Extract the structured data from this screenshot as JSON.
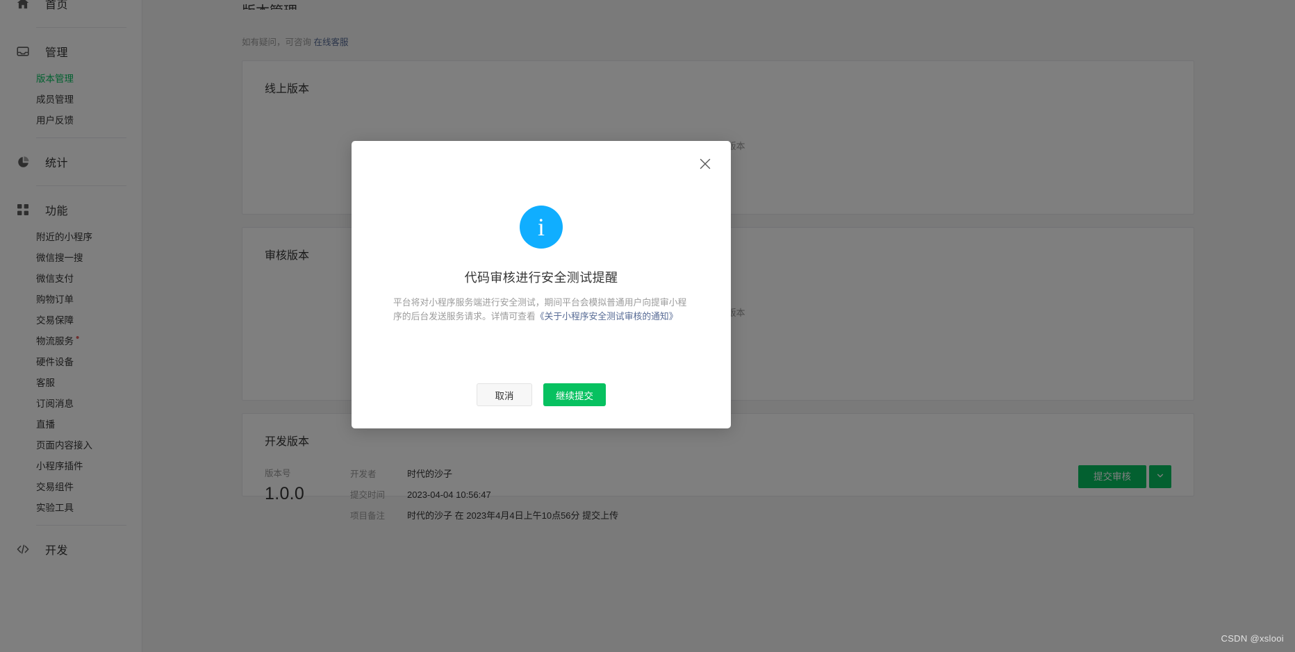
{
  "sidebar": {
    "groups": [
      {
        "icon": "home-icon",
        "label": "首页",
        "items": []
      },
      {
        "icon": "inbox-icon",
        "label": "管理",
        "items": [
          {
            "label": "版本管理",
            "active": true
          },
          {
            "label": "成员管理",
            "active": false
          },
          {
            "label": "用户反馈",
            "active": false
          }
        ]
      },
      {
        "icon": "pie-chart-icon",
        "label": "统计",
        "items": []
      },
      {
        "icon": "grid-icon",
        "label": "功能",
        "items": [
          {
            "label": "附近的小程序",
            "active": false
          },
          {
            "label": "微信搜一搜",
            "active": false
          },
          {
            "label": "微信支付",
            "active": false
          },
          {
            "label": "购物订单",
            "active": false
          },
          {
            "label": "交易保障",
            "active": false
          },
          {
            "label": "物流服务",
            "active": false,
            "badge": "•"
          },
          {
            "label": "硬件设备",
            "active": false
          },
          {
            "label": "客服",
            "active": false
          },
          {
            "label": "订阅消息",
            "active": false
          },
          {
            "label": "直播",
            "active": false
          },
          {
            "label": "页面内容接入",
            "active": false
          },
          {
            "label": "小程序插件",
            "active": false
          },
          {
            "label": "交易组件",
            "active": false
          },
          {
            "label": "实验工具",
            "active": false
          }
        ]
      },
      {
        "icon": "code-icon",
        "label": "开发",
        "items": []
      }
    ]
  },
  "main": {
    "page_title": "版本管理",
    "hint_prefix": "如有疑问，可咨询",
    "hint_link": "在线客服",
    "cards": {
      "online": {
        "title": "线上版本",
        "empty": "暂无线上版本"
      },
      "audit": {
        "title": "审核版本",
        "empty": "暂无审核版本"
      },
      "dev": {
        "title": "开发版本",
        "version_label": "版本号",
        "version_value": "1.0.0",
        "meta": [
          {
            "key": "开发者",
            "value": "时代的沙子"
          },
          {
            "key": "提交时间",
            "value": "2023-04-04 10:56:47"
          },
          {
            "key": "项目备注",
            "value": "时代的沙子 在 2023年4月4日上午10点56分 提交上传"
          }
        ],
        "submit_label": "提交审核",
        "more_icon": "chevron-down-icon"
      }
    }
  },
  "modal": {
    "close_icon": "close-icon",
    "info_icon": "info-icon",
    "icon_glyph": "i",
    "title": "代码审核进行安全测试提醒",
    "text_before_link": "平台将对小程序服务端进行安全测试，期间平台会模拟普通用户向提审小程序的后台发送服务请求。详情可查看",
    "link_text": "《关于小程序安全测试审核的通知》",
    "cancel_label": "取消",
    "confirm_label": "继续提交"
  },
  "watermark": "CSDN @xslooi",
  "colors": {
    "brand_green": "#07c160",
    "info_blue": "#10aeff",
    "link_blue": "#576b95",
    "text_primary": "#353535",
    "text_muted": "#9a9a9a",
    "border": "#e7e7eb",
    "badge_red": "#e15f5f"
  }
}
